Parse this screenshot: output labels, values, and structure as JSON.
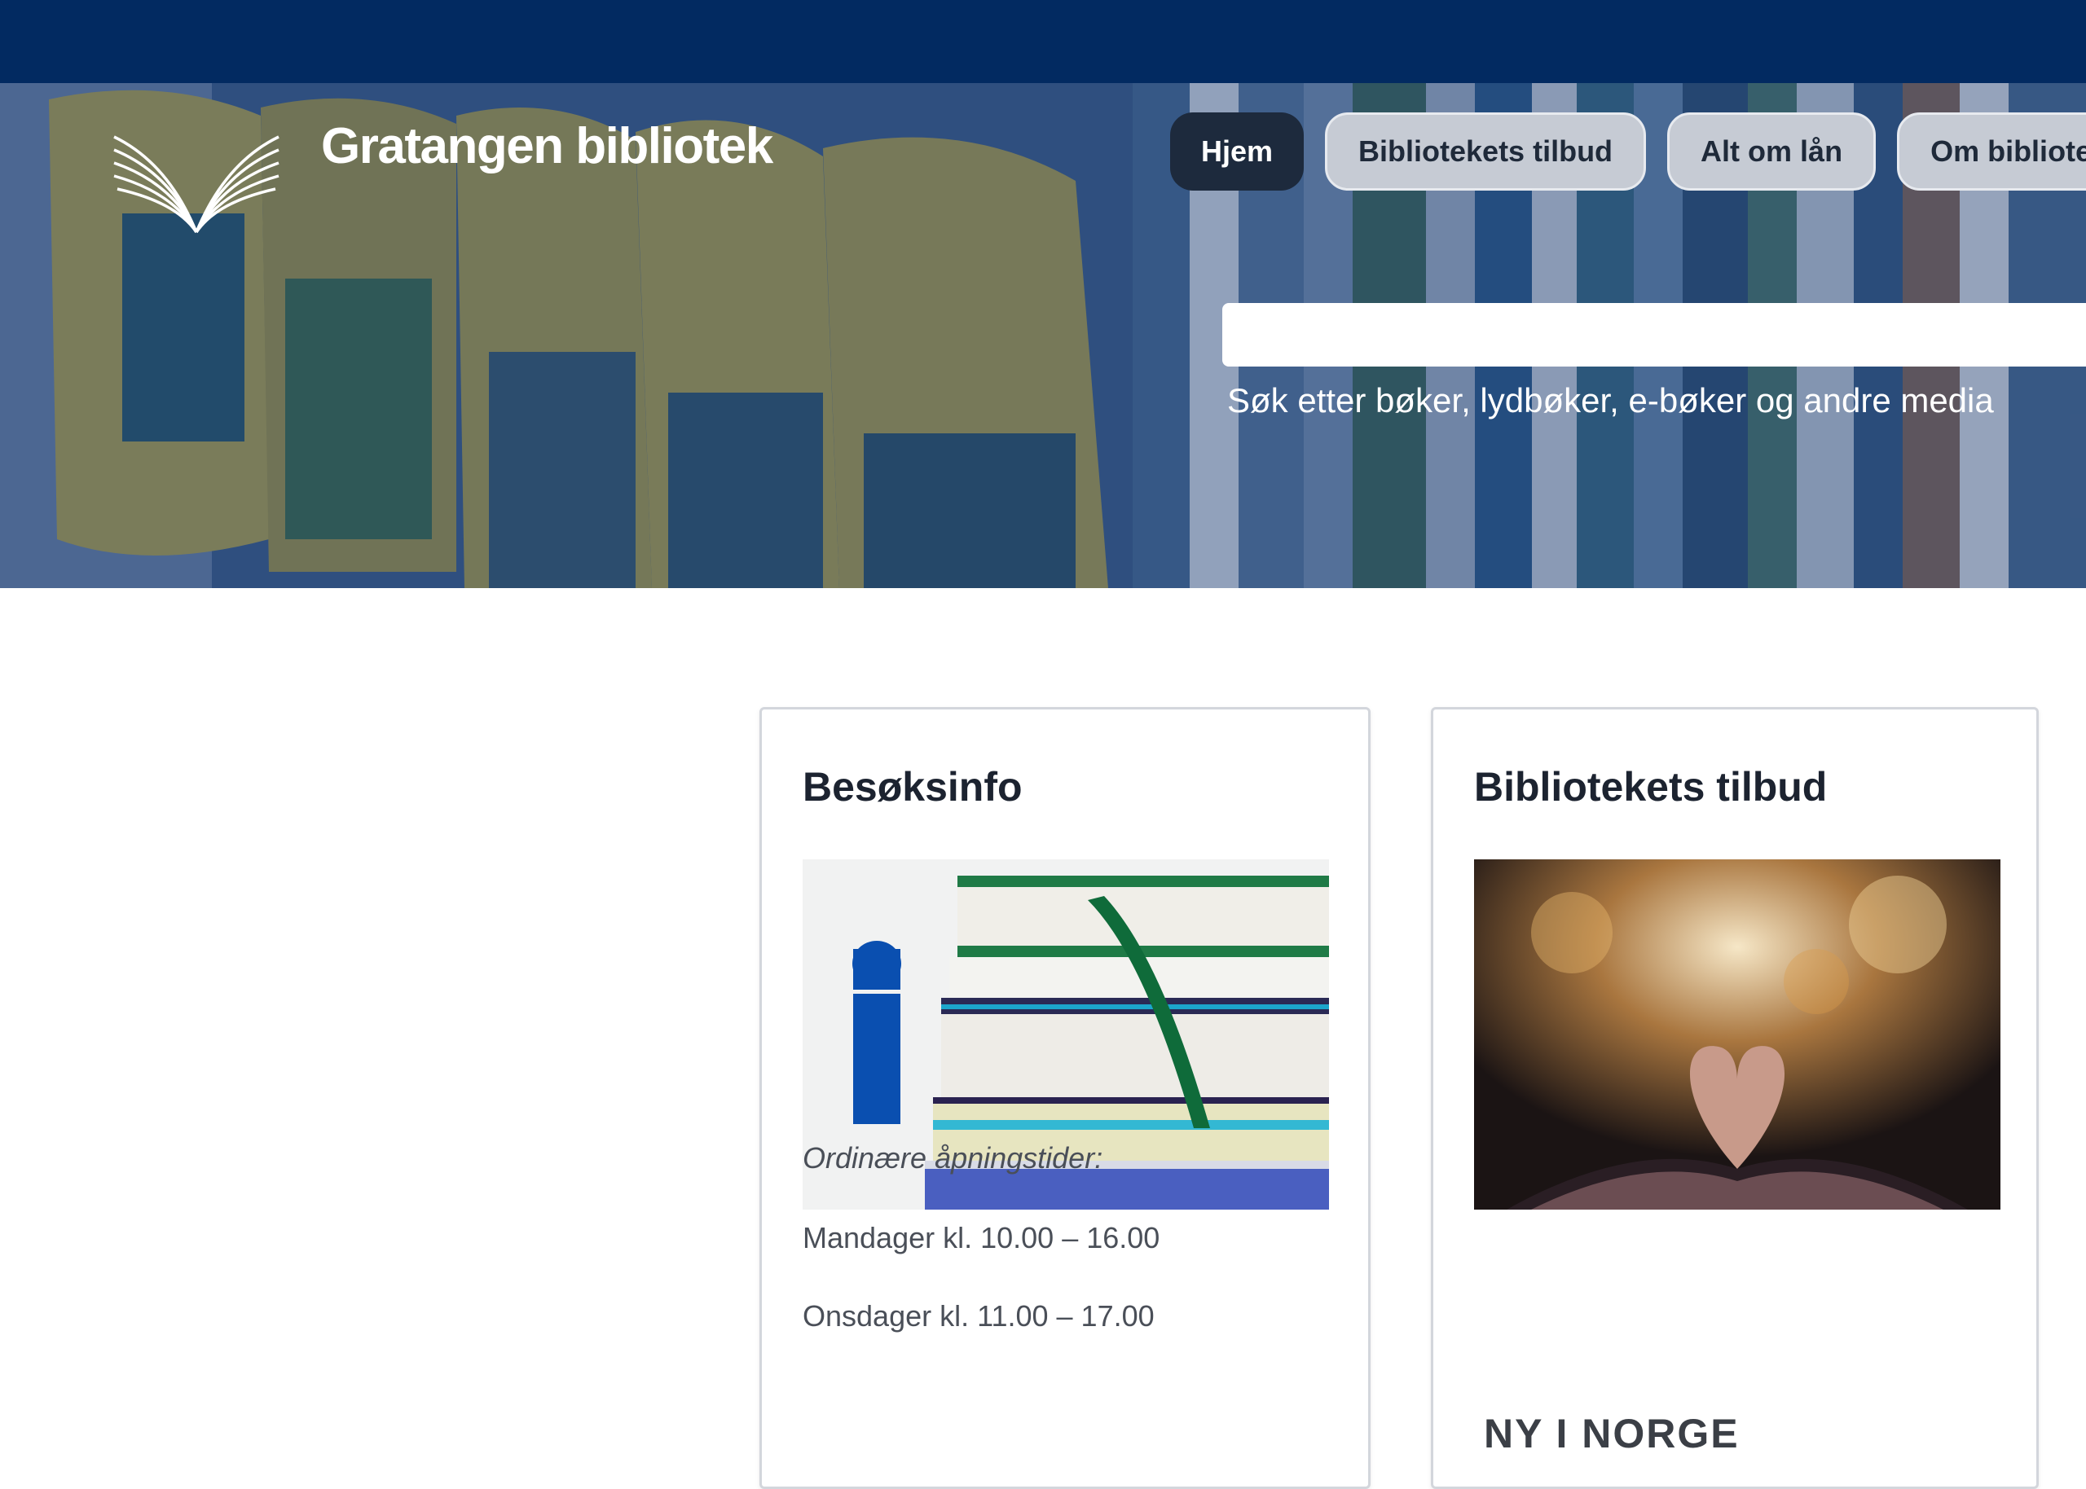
{
  "site": {
    "title": "Gratangen bibliotek"
  },
  "nav": {
    "items": [
      {
        "label": "Hjem",
        "active": true
      },
      {
        "label": "Bibliotekets tilbud",
        "active": false
      },
      {
        "label": "Alt om lån",
        "active": false
      },
      {
        "label": "Om biblioteket",
        "active": false
      }
    ]
  },
  "search": {
    "value": "",
    "hint": "Søk etter bøker, lydbøker, e-bøker og andre media"
  },
  "cards": {
    "visit": {
      "title": "Besøksinfo",
      "intro": "Ordinære åpningstider:",
      "hours": [
        "Mandager kl. 10.00 – 16.00",
        "Onsdager kl. 11.00 – 17.00"
      ]
    },
    "offer": {
      "title": "Bibliotekets tilbud",
      "footer_text": "NY I NORGE"
    }
  },
  "colors": {
    "topbar": "#022a61",
    "nav_active": "#1d2a3d",
    "nav_inactive": "#c6cbd4"
  },
  "icons": {
    "logo": "open-book-logo-icon",
    "info": "info-icon"
  }
}
